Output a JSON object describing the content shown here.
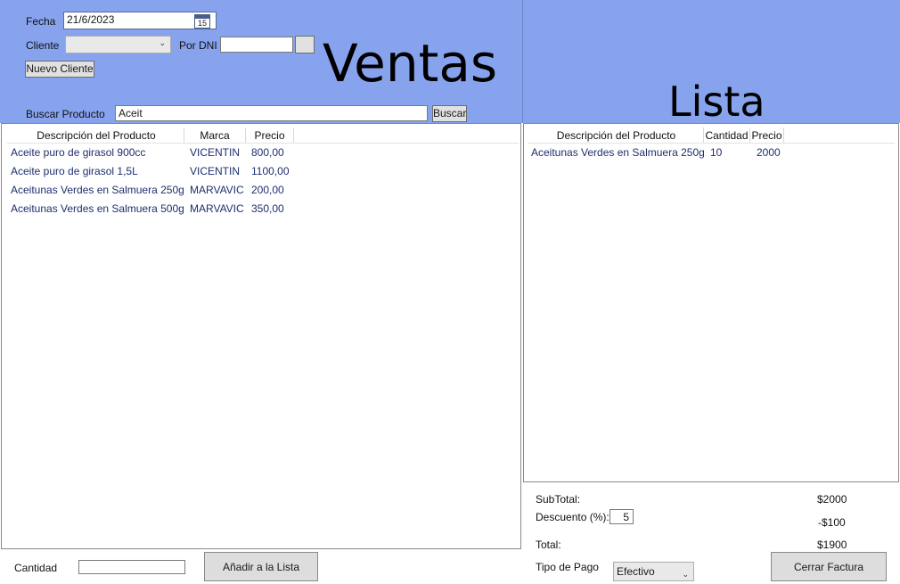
{
  "header": {
    "fecha_label": "Fecha",
    "fecha_value": "21/6/2023",
    "calendar_day": "15",
    "cliente_label": "Cliente",
    "cliente_value": "",
    "por_dni_label": "Por DNI",
    "dni_value": "",
    "nuevo_cliente_label": "Nuevo Cliente",
    "ventas_title": "Ventas",
    "lista_title": "Lista",
    "buscar_producto_label": "Buscar Producto",
    "buscar_value": "Aceit",
    "buscar_button": "Buscar"
  },
  "products": {
    "columns": [
      "Descripción del Producto",
      "Marca",
      "Precio"
    ],
    "rows": [
      {
        "descripcion": "Aceite puro de girasol 900cc",
        "marca": "VICENTIN",
        "precio": "800,00"
      },
      {
        "descripcion": "Aceite puro de girasol 1,5L",
        "marca": "VICENTIN",
        "precio": "1100,00"
      },
      {
        "descripcion": "Aceitunas Verdes en Salmuera 250g",
        "marca": "MARVAVIC",
        "precio": "200,00"
      },
      {
        "descripcion": "Aceitunas Verdes en Salmuera 500g",
        "marca": "MARVAVIC",
        "precio": "350,00"
      }
    ]
  },
  "lista": {
    "columns": [
      "Descripción del Producto",
      "Cantidad",
      "Precio"
    ],
    "rows": [
      {
        "descripcion": "Aceitunas Verdes en Salmuera 250g",
        "cantidad": "10",
        "precio": "2000"
      }
    ]
  },
  "bottom": {
    "cantidad_label": "Cantidad",
    "cantidad_value": "",
    "anadir_button": "Añadir a la Lista"
  },
  "totals": {
    "subtotal_label": "SubTotal:",
    "subtotal_value": "$2000",
    "descuento_label": "Descuento (%):",
    "descuento_value": "5",
    "descuento_amount": "-$100",
    "total_label": "Total:",
    "total_value": "$1900",
    "tipo_pago_label": "Tipo de Pago",
    "tipo_pago_value": "Efectivo",
    "cerrar_button": "Cerrar Factura"
  }
}
